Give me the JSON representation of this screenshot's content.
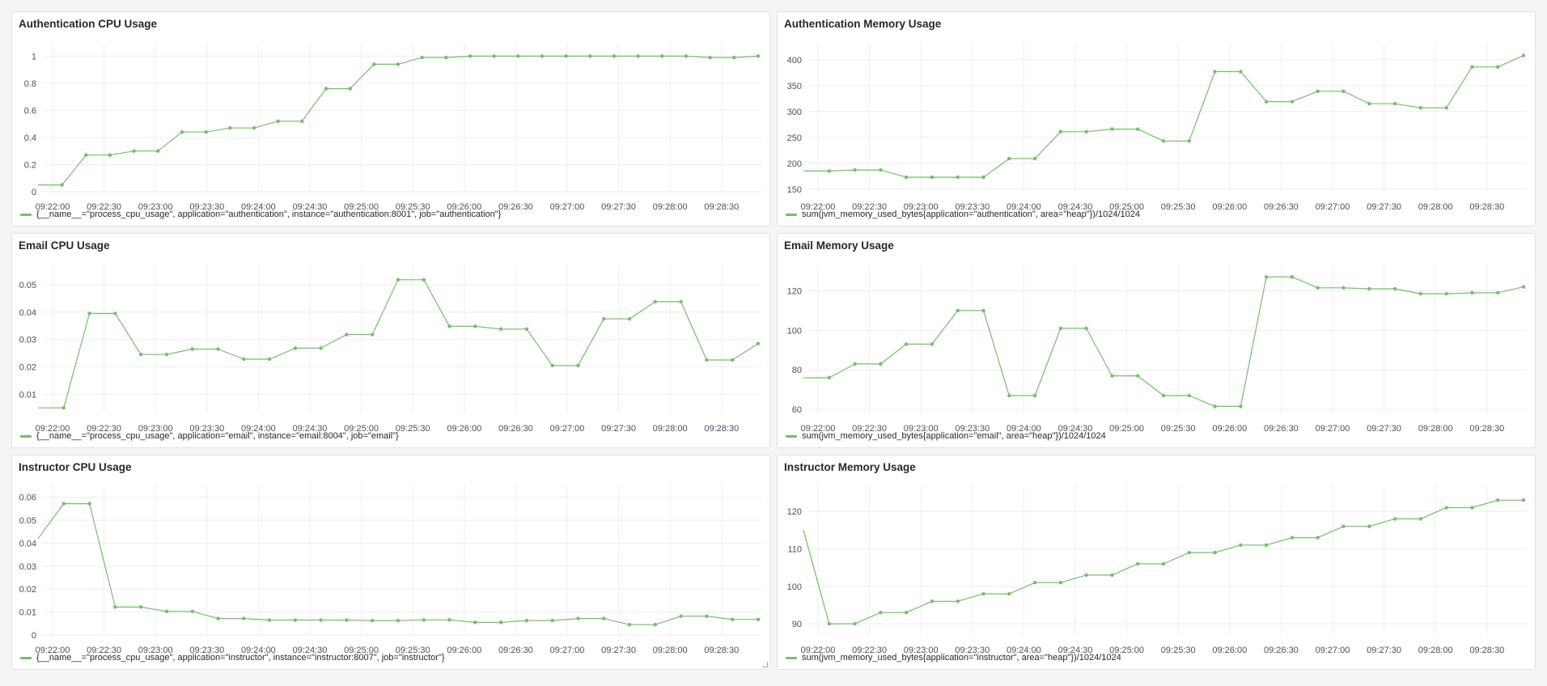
{
  "dashboard": {
    "panels": [
      {
        "title": "Authentication CPU Usage",
        "legend": "{__name__=\"process_cpu_usage\", application=\"authentication\", instance=\"authentication:8001\", job=\"authentication\"}"
      },
      {
        "title": "Authentication Memory Usage",
        "legend": "sum(jvm_memory_used_bytes{application=\"authentication\", area=\"heap\"})/1024/1024"
      },
      {
        "title": "Email CPU Usage",
        "legend": "{__name__=\"process_cpu_usage\", application=\"email\", instance=\"email:8004\", job=\"email\"}"
      },
      {
        "title": "Email Memory Usage",
        "legend": "sum(jvm_memory_used_bytes{application=\"email\", area=\"heap\"})/1024/1024"
      },
      {
        "title": "Instructor CPU Usage",
        "legend": "{__name__=\"process_cpu_usage\", application=\"instructor\", instance=\"instructor:8007\", job=\"instructor\"}"
      },
      {
        "title": "Instructor Memory Usage",
        "legend": "sum(jvm_memory_used_bytes{application=\"instructor\", area=\"heap\"})/1024/1024"
      }
    ]
  },
  "colors": {
    "series": "#73bf69",
    "grid": "#eceef0",
    "axis_text": "#4b5058"
  },
  "chart_data": [
    {
      "type": "line",
      "title": "Authentication CPU Usage",
      "x_ticks": [
        "09:22:00",
        "09:22:30",
        "09:23:00",
        "09:23:30",
        "09:24:00",
        "09:24:30",
        "09:25:00",
        "09:25:30",
        "09:26:00",
        "09:26:30",
        "09:27:00",
        "09:27:30",
        "09:28:00",
        "09:28:30"
      ],
      "y_ticks": [
        "0",
        "0.2",
        "0.4",
        "0.6",
        "0.8",
        "1"
      ],
      "ylim": [
        0,
        1.05
      ],
      "series": [
        {
          "name": "{__name__=\"process_cpu_usage\", application=\"authentication\", instance=\"authentication:8001\", job=\"authentication\"}",
          "first_point_marker": false,
          "values": [
            0.05,
            0.05,
            0.27,
            0.27,
            0.3,
            0.3,
            0.44,
            0.44,
            0.47,
            0.47,
            0.52,
            0.52,
            0.76,
            0.76,
            0.94,
            0.94,
            0.99,
            0.99,
            1.0,
            1.0,
            1.0,
            1.0,
            1.0,
            1.0,
            1.0,
            1.0,
            1.0,
            1.0,
            0.99,
            0.99,
            1.0
          ]
        }
      ]
    },
    {
      "type": "line",
      "title": "Authentication Memory Usage",
      "x_ticks": [
        "09:22:00",
        "09:22:30",
        "09:23:00",
        "09:23:30",
        "09:24:00",
        "09:24:30",
        "09:25:00",
        "09:25:30",
        "09:26:00",
        "09:26:30",
        "09:27:00",
        "09:27:30",
        "09:28:00",
        "09:28:30"
      ],
      "y_ticks": [
        "150",
        "200",
        "250",
        "300",
        "350",
        "400"
      ],
      "ylim": [
        145,
        420
      ],
      "series": [
        {
          "name": "sum(jvm_memory_used_bytes{application=\"authentication\", area=\"heap\"})/1024/1024",
          "first_point_marker": false,
          "values": [
            185,
            185,
            187,
            187,
            173,
            173,
            173,
            173,
            209,
            209,
            261,
            261,
            266,
            266,
            243,
            243,
            377,
            377,
            319,
            319,
            339,
            339,
            315,
            315,
            307,
            307,
            386,
            386,
            408
          ]
        }
      ]
    },
    {
      "type": "line",
      "title": "Email CPU Usage",
      "x_ticks": [
        "09:22:00",
        "09:22:30",
        "09:23:00",
        "09:23:30",
        "09:24:00",
        "09:24:30",
        "09:25:00",
        "09:25:30",
        "09:26:00",
        "09:26:30",
        "09:27:00",
        "09:27:30",
        "09:28:00",
        "09:28:30"
      ],
      "y_ticks": [
        "0.01",
        "0.02",
        "0.03",
        "0.04",
        "0.05"
      ],
      "ylim": [
        0.003,
        0.055
      ],
      "series": [
        {
          "name": "{__name__=\"process_cpu_usage\", application=\"email\", instance=\"email:8004\", job=\"email\"}",
          "first_point_marker": false,
          "values": [
            0.005,
            0.005,
            0.0395,
            0.0395,
            0.0245,
            0.0245,
            0.0265,
            0.0265,
            0.0228,
            0.0228,
            0.0268,
            0.0268,
            0.0318,
            0.0318,
            0.0518,
            0.0518,
            0.0348,
            0.0348,
            0.0338,
            0.0338,
            0.0205,
            0.0205,
            0.0375,
            0.0375,
            0.0438,
            0.0438,
            0.0225,
            0.0225,
            0.0285
          ]
        }
      ]
    },
    {
      "type": "line",
      "title": "Email Memory Usage",
      "x_ticks": [
        "09:22:00",
        "09:22:30",
        "09:23:00",
        "09:23:30",
        "09:24:00",
        "09:24:30",
        "09:25:00",
        "09:25:30",
        "09:26:00",
        "09:26:30",
        "09:27:00",
        "09:27:30",
        "09:28:00",
        "09:28:30"
      ],
      "y_ticks": [
        "60",
        "80",
        "100",
        "120"
      ],
      "ylim": [
        58,
        130
      ],
      "series": [
        {
          "name": "sum(jvm_memory_used_bytes{application=\"email\", area=\"heap\"})/1024/1024",
          "first_point_marker": false,
          "values": [
            76,
            76,
            83,
            83,
            93,
            93,
            110,
            110,
            67,
            67,
            101,
            101,
            77,
            77,
            67,
            67,
            61.5,
            61.5,
            127,
            127,
            121.5,
            121.5,
            121,
            121,
            118.5,
            118.5,
            119,
            119,
            122
          ]
        }
      ]
    },
    {
      "type": "line",
      "title": "Instructor CPU Usage",
      "x_ticks": [
        "09:22:00",
        "09:22:30",
        "09:23:00",
        "09:23:30",
        "09:24:00",
        "09:24:30",
        "09:25:00",
        "09:25:30",
        "09:26:00",
        "09:26:30",
        "09:27:00",
        "09:27:30",
        "09:28:00",
        "09:28:30"
      ],
      "y_ticks": [
        "0",
        "0.01",
        "0.02",
        "0.03",
        "0.04",
        "0.05",
        "0.06"
      ],
      "ylim": [
        0,
        0.062
      ],
      "series": [
        {
          "name": "{__name__=\"process_cpu_usage\", application=\"instructor\", instance=\"instructor:8007\", job=\"instructor\"}",
          "first_point_marker": false,
          "values": [
            0.042,
            0.0572,
            0.0572,
            0.0122,
            0.0122,
            0.0103,
            0.0103,
            0.0072,
            0.0072,
            0.0065,
            0.0065,
            0.0065,
            0.0065,
            0.0063,
            0.0063,
            0.0066,
            0.0066,
            0.0055,
            0.0055,
            0.0063,
            0.0063,
            0.0072,
            0.0072,
            0.0045,
            0.0045,
            0.0082,
            0.0082,
            0.0068,
            0.0068
          ]
        }
      ]
    },
    {
      "type": "line",
      "title": "Instructor Memory Usage",
      "x_ticks": [
        "09:22:00",
        "09:22:30",
        "09:23:00",
        "09:23:30",
        "09:24:00",
        "09:24:30",
        "09:25:00",
        "09:25:30",
        "09:26:00",
        "09:26:30",
        "09:27:00",
        "09:27:30",
        "09:28:00",
        "09:28:30"
      ],
      "y_ticks": [
        "90",
        "100",
        "110",
        "120"
      ],
      "ylim": [
        87,
        125
      ],
      "series": [
        {
          "name": "sum(jvm_memory_used_bytes{application=\"instructor\", area=\"heap\"})/1024/1024",
          "first_point_marker": false,
          "values": [
            115,
            90,
            90,
            93,
            93,
            96,
            96,
            98,
            98,
            101,
            101,
            103,
            103,
            106,
            106,
            109,
            109,
            111,
            111,
            113,
            113,
            116,
            116,
            118,
            118,
            121,
            121,
            123,
            123
          ]
        }
      ]
    }
  ]
}
